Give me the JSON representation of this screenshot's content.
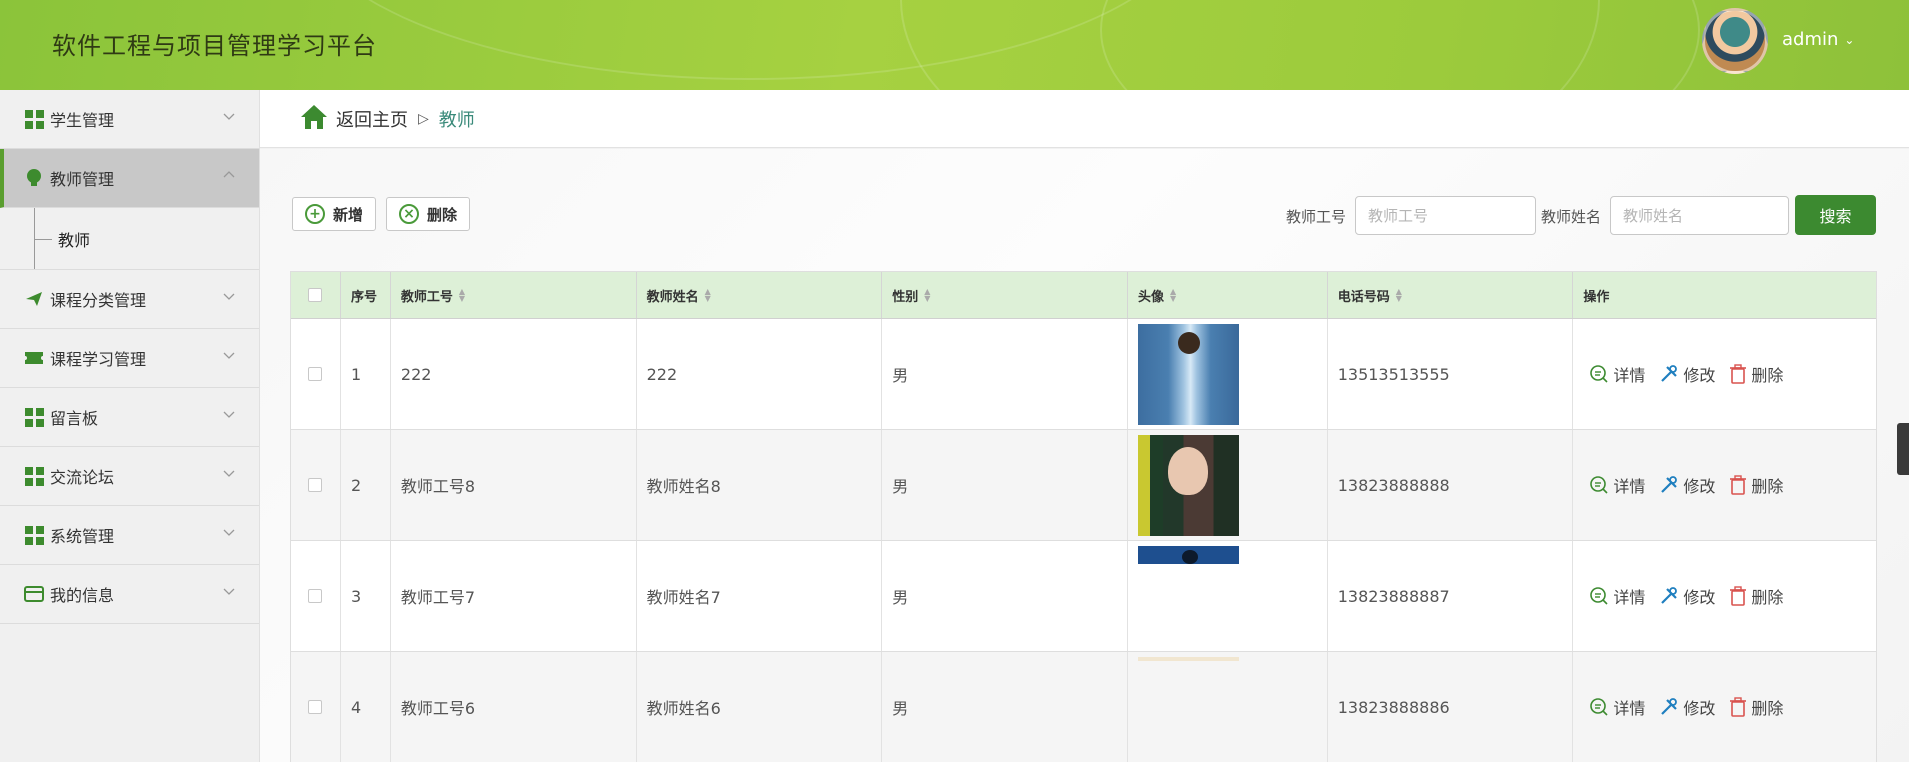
{
  "header": {
    "title": "软件工程与项目管理学习平台",
    "username": "admin"
  },
  "sidebar": {
    "items": [
      {
        "label": "学生管理",
        "icon": "grid-icon"
      },
      {
        "label": "教师管理",
        "icon": "bulb-icon",
        "active": true
      },
      {
        "label": "课程分类管理",
        "icon": "paper-plane-icon"
      },
      {
        "label": "课程学习管理",
        "icon": "ticket-icon"
      },
      {
        "label": "留言板",
        "icon": "grid-icon"
      },
      {
        "label": "交流论坛",
        "icon": "grid-icon"
      },
      {
        "label": "系统管理",
        "icon": "grid-icon"
      },
      {
        "label": "我的信息",
        "icon": "wallet-icon"
      }
    ],
    "subitems": [
      {
        "label": "教师"
      }
    ]
  },
  "breadcrumb": {
    "home": "返回主页",
    "current": "教师"
  },
  "toolbar": {
    "add_label": "新增",
    "delete_label": "删除"
  },
  "search": {
    "teacher_id_label": "教师工号",
    "teacher_id_placeholder": "教师工号",
    "teacher_name_label": "教师姓名",
    "teacher_name_placeholder": "教师姓名",
    "button_label": "搜索"
  },
  "table": {
    "headers": [
      "序号",
      "教师工号",
      "教师姓名",
      "性别",
      "头像",
      "电话号码",
      "操作"
    ],
    "rows": [
      {
        "index": "1",
        "teacher_id": "222",
        "name": "222",
        "gender": "男",
        "phone": "13513513555"
      },
      {
        "index": "2",
        "teacher_id": "教师工号8",
        "name": "教师姓名8",
        "gender": "男",
        "phone": "13823888888"
      },
      {
        "index": "3",
        "teacher_id": "教师工号7",
        "name": "教师姓名7",
        "gender": "男",
        "phone": "13823888887"
      },
      {
        "index": "4",
        "teacher_id": "教师工号6",
        "name": "教师姓名6",
        "gender": "男",
        "phone": "13823888886"
      }
    ],
    "actions": {
      "detail": "详情",
      "edit": "修改",
      "delete": "删除"
    }
  },
  "colors": {
    "header_green": "#a6d141",
    "accent_green": "#3c8a30",
    "table_header_bg": "#ddf0d7",
    "delete_red": "#d9534f"
  }
}
